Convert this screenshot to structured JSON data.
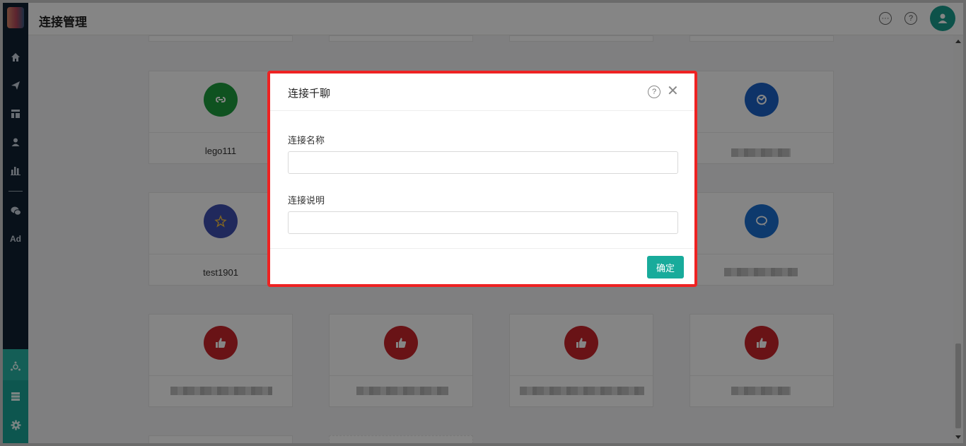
{
  "header": {
    "title": "连接管理",
    "message_icon": "message-icon",
    "help_icon": "help-icon",
    "avatar_icon": "user-icon"
  },
  "sidebar": {
    "items": [
      {
        "icon": "home-icon"
      },
      {
        "icon": "send-icon"
      },
      {
        "icon": "layout-icon"
      },
      {
        "icon": "user-icon"
      },
      {
        "icon": "bar-chart-icon"
      },
      {
        "icon": "wechat-icon"
      },
      {
        "icon": "ad-icon",
        "label": "Ad"
      }
    ],
    "bottom_items": [
      {
        "icon": "connection-icon"
      },
      {
        "icon": "server-icon"
      },
      {
        "icon": "gear-icon"
      }
    ]
  },
  "cards": [
    {
      "name": "lego111",
      "color": "#1e9e3e",
      "icon": "miniprogram-icon"
    },
    {
      "name": "test1901",
      "color": "#3f4fb0",
      "icon": "star-icon"
    },
    {
      "name": "",
      "color": "#1b63c7",
      "icon": "service-icon"
    },
    {
      "name": "",
      "color": "#1b6fd1",
      "icon": "chat-icon"
    },
    {
      "name": "",
      "color": "#c9252b",
      "icon": "thumbs-up-icon"
    },
    {
      "name": "",
      "color": "#c9252b",
      "icon": "thumbs-up-icon"
    },
    {
      "name": "",
      "color": "#c9252b",
      "icon": "thumbs-up-icon"
    },
    {
      "name": "",
      "color": "#c9252b",
      "icon": "thumbs-up-icon"
    }
  ],
  "modal": {
    "title": "连接千聊",
    "name_label": "连接名称",
    "name_value": "",
    "desc_label": "连接说明",
    "desc_value": "",
    "confirm_label": "确定"
  },
  "colors": {
    "accent": "#18ab9b",
    "sidebar": "#102233",
    "highlight": "#ee2222"
  }
}
